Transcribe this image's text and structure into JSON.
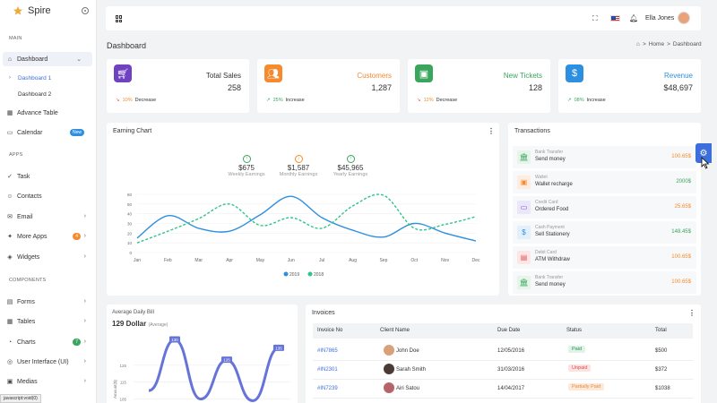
{
  "brand": {
    "name": "Spire"
  },
  "sidebar": {
    "main_title": "MAIN",
    "apps_title": "APPS",
    "components_title": "COMPONENTS",
    "dashboard": "Dashboard",
    "dashboard1": "Dashboard 1",
    "dashboard2": "Dashboard 2",
    "advance_table": "Advance Table",
    "calendar": "Calendar",
    "calendar_badge": "New",
    "task": "Task",
    "contacts": "Contacts",
    "email": "Email",
    "more_apps": "More Apps",
    "more_apps_badge": "4",
    "widgets": "Widgets",
    "forms": "Forms",
    "tables": "Tables",
    "charts": "Charts",
    "charts_badge": "7",
    "ui": "User Interface (UI)",
    "medias": "Medias"
  },
  "statusbar": {
    "text": "javascript:void(0)"
  },
  "topbar": {
    "user_name": "Ella Jones"
  },
  "page": {
    "title": "Dashboard",
    "crumb_home": "Home",
    "crumb_sep": ">",
    "crumb_current": "Dashboard"
  },
  "stats": [
    {
      "title": "Total Sales",
      "value": "258",
      "pct": "10%",
      "trend": "Decrease",
      "color": "#6f42c1",
      "title_color": "#333333"
    },
    {
      "title": "Customers",
      "value": "1,287",
      "pct": "25%",
      "trend": "Increase",
      "color": "#f58b2e",
      "title_color": "#f58b2e"
    },
    {
      "title": "New Tickets",
      "value": "128",
      "pct": "12%",
      "trend": "Decrease",
      "color": "#3aa55d",
      "title_color": "#3aa55d"
    },
    {
      "title": "Revenue",
      "value": "$48,697",
      "pct": "08%",
      "trend": "Increase",
      "color": "#2d8fe0",
      "title_color": "#2d8fe0"
    }
  ],
  "earning": {
    "title": "Earning Chart",
    "summary": [
      {
        "value": "$675",
        "label": "Weekly Earnings",
        "color": "#3aa55d"
      },
      {
        "value": "$1,587",
        "label": "Monthly Earnings",
        "color": "#f58b2e"
      },
      {
        "value": "$45,965",
        "label": "Yearly Earnings",
        "color": "#3aa55d"
      }
    ]
  },
  "chart_data": [
    {
      "type": "line",
      "categories": [
        "Jan",
        "Feb",
        "Mar",
        "Apr",
        "May",
        "Jun",
        "Jul",
        "Aug",
        "Sep",
        "Oct",
        "Nov",
        "Dec"
      ],
      "ylim": [
        0,
        60
      ],
      "yticks": [
        0,
        10,
        20,
        30,
        40,
        50,
        60
      ],
      "legend": "bottom",
      "series": [
        {
          "name": "2019",
          "color": "#2d8fe0",
          "dashed": false,
          "values": [
            15,
            38,
            25,
            22,
            39,
            58,
            36,
            23,
            16,
            30,
            20,
            12
          ]
        },
        {
          "name": "2018",
          "color": "#2fc48a",
          "dashed": true,
          "values": [
            10,
            22,
            35,
            50,
            28,
            36,
            25,
            48,
            59,
            25,
            29,
            37
          ]
        }
      ]
    },
    {
      "type": "line",
      "title": "Average Daily Bill",
      "ylabel": "Amount($)",
      "yticks": [
        105,
        115,
        125
      ],
      "visible_range": [
        100,
        145
      ],
      "series": [
        {
          "name": "",
          "color": "#6674d9",
          "values": [
            null,
            110,
            140,
            105,
            128,
            104,
            135
          ]
        }
      ],
      "point_labels": [
        "",
        "",
        "130",
        "",
        "125",
        "",
        "135"
      ]
    }
  ],
  "transactions": {
    "title": "Transactions",
    "items": [
      {
        "type": "Bank Transfer",
        "desc": "Send money",
        "amount": "100.65$",
        "amount_color": "#f58b2e",
        "icon": "🏛",
        "bg": "#e6f4ea",
        "fg": "#3aa55d"
      },
      {
        "type": "Wallet",
        "desc": "Wallet recharge",
        "amount": "2000$",
        "amount_color": "#3aa55d",
        "icon": "▣",
        "bg": "#fdecdf",
        "fg": "#f58b2e"
      },
      {
        "type": "Credit Card",
        "desc": "Ordered Food",
        "amount": "25.65$",
        "amount_color": "#f58b2e",
        "icon": "▭",
        "bg": "#ece6fa",
        "fg": "#6f42c1"
      },
      {
        "type": "Cash Payment",
        "desc": "Sell Stationery",
        "amount": "148.45$",
        "amount_color": "#3aa55d",
        "icon": "$",
        "bg": "#e3f0fb",
        "fg": "#2d8fe0"
      },
      {
        "type": "Debit Card",
        "desc": "ATM Withdraw",
        "amount": "100.65$",
        "amount_color": "#f58b2e",
        "icon": "▤",
        "bg": "#fde6e6",
        "fg": "#e05252"
      },
      {
        "type": "Bank Transfer",
        "desc": "Send money",
        "amount": "100.65$",
        "amount_color": "#f58b2e",
        "icon": "🏛",
        "bg": "#e6f4ea",
        "fg": "#3aa55d"
      }
    ]
  },
  "avg_bill": {
    "title": "Average Daily Bill",
    "value": "129 Dollar",
    "sub": "(Average)"
  },
  "invoices": {
    "title": "Invoices",
    "columns": [
      "Invoice No",
      "Client Name",
      "Due Date",
      "Status",
      "Total"
    ],
    "rows": [
      {
        "no": "#IN7865",
        "client": "John Doe",
        "due": "12/05/2016",
        "status": "Paid",
        "total": "$500",
        "status_bg": "#dff3e6",
        "status_fg": "#2e8b4f",
        "avatar": "#d9a07a"
      },
      {
        "no": "#IN2301",
        "client": "Sarah Smith",
        "due": "31/03/2016",
        "status": "Unpaid",
        "total": "$372",
        "status_bg": "#fde2e2",
        "status_fg": "#d9534f",
        "avatar": "#4a3b36"
      },
      {
        "no": "#IN7239",
        "client": "Airi Satou",
        "due": "14/04/2017",
        "status": "Partially Paid",
        "total": "$1038",
        "status_bg": "#fde9d9",
        "status_fg": "#e58a3a",
        "avatar": "#b5656a"
      }
    ]
  }
}
